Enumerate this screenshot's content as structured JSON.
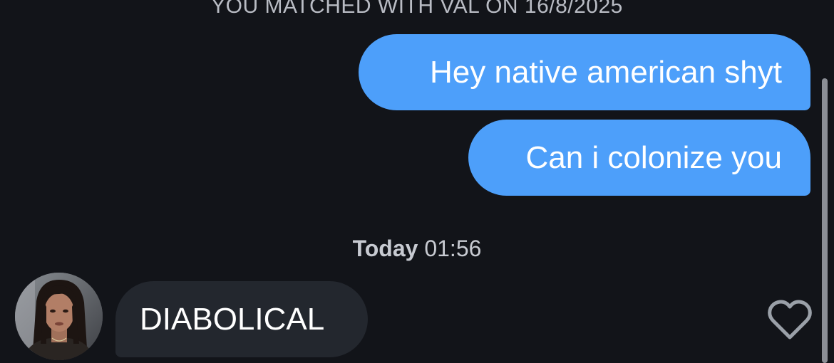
{
  "chat": {
    "match_banner": "YOU MATCHED WITH VAL ON 16/8/2025",
    "messages_sent": [
      "Hey native american shyt",
      "Can i colonize you"
    ],
    "timestamp": {
      "day": "Today",
      "time": "01:56"
    },
    "message_received": "DIABOLICAL",
    "like_icon": "heart-outline-icon"
  },
  "colors": {
    "background": "#121419",
    "sent_bubble": "#4d9ffa",
    "received_bubble": "#23272e",
    "secondary_text": "#b9bcc4"
  }
}
